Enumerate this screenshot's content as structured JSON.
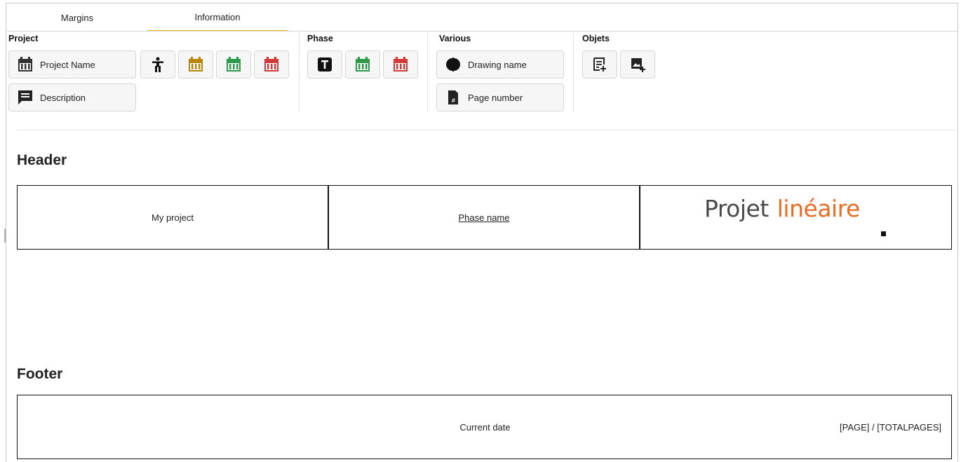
{
  "tabs": [
    {
      "label": "Margins",
      "active": false
    },
    {
      "label": "Information",
      "active": true
    }
  ],
  "ribbon": {
    "project": {
      "title": "Project",
      "project_name": "Project Name",
      "description": "Description",
      "icons": [
        "person-icon",
        "calendar-gold-icon",
        "calendar-green-icon",
        "calendar-red-icon"
      ]
    },
    "phase": {
      "title": "Phase",
      "icons": [
        "text-t-icon",
        "calendar-green-icon",
        "calendar-red-icon"
      ]
    },
    "various": {
      "title": "Various",
      "drawing_name": "Drawing name",
      "page_number": "Page number"
    },
    "objects": {
      "title": "Objets",
      "icons": [
        "add-text-block-icon",
        "add-image-icon"
      ]
    }
  },
  "header": {
    "title": "Header",
    "left": "My project",
    "center": "Phase name",
    "logo_word1": "Projet",
    "logo_word2": "linéaire"
  },
  "footer": {
    "title": "Footer",
    "center": "Current date",
    "right": "[PAGE] / [TOTALPAGES]"
  },
  "colors": {
    "accent_tab": "#f2b705",
    "calendar_dark": "#333333",
    "calendar_gold": "#b8860b",
    "calendar_green": "#2e9b4a",
    "calendar_red": "#d23a3a",
    "logo_gray": "#4a4a4a",
    "logo_orange": "#ea6c25"
  }
}
